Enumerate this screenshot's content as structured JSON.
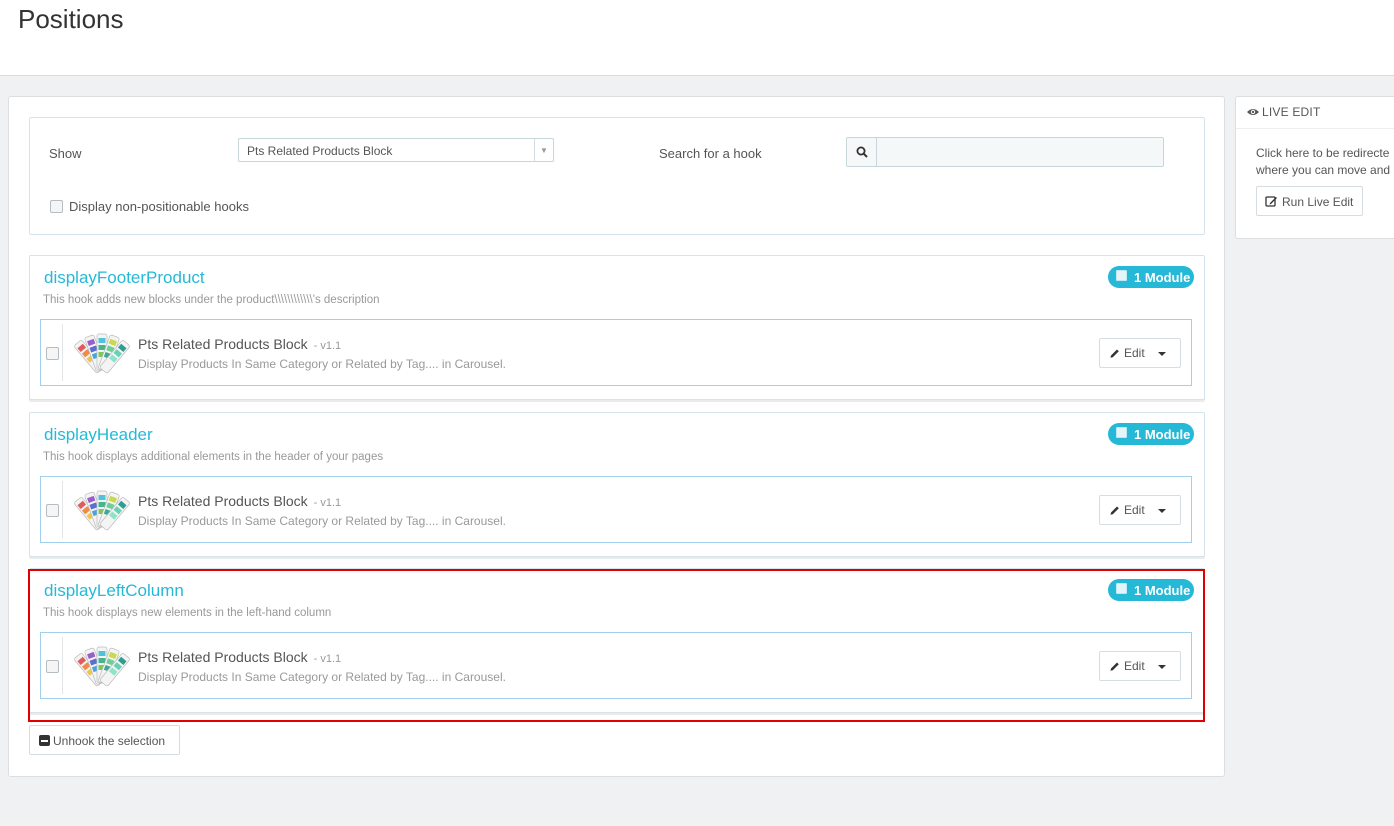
{
  "header": {
    "title": "Positions"
  },
  "filters": {
    "show_label": "Show",
    "show_selected": "Pts Related Products Block",
    "search_label": "Search for a hook",
    "search_value": "",
    "non_positionable_label": "Display non-positionable hooks"
  },
  "hooks": [
    {
      "name": "displayFooterProduct",
      "description": "This hook adds new blocks under the product\\\\\\\\\\\\\\\\\\\\\\\\'s description",
      "badge": "1 Module",
      "module": {
        "name": "Pts Related Products Block",
        "version": "- v1.1",
        "description": "Display Products In Same Category or Related by Tag.... in Carousel.",
        "edit_label": "Edit"
      }
    },
    {
      "name": "displayHeader",
      "description": "This hook displays additional elements in the header of your pages",
      "badge": "1 Module",
      "module": {
        "name": "Pts Related Products Block",
        "version": "- v1.1",
        "description": "Display Products In Same Category or Related by Tag.... in Carousel.",
        "edit_label": "Edit"
      }
    },
    {
      "name": "displayLeftColumn",
      "description": "This hook displays new elements in the left-hand column",
      "badge": "1 Module",
      "module": {
        "name": "Pts Related Products Block",
        "version": "- v1.1",
        "description": "Display Products In Same Category or Related by Tag.... in Carousel.",
        "edit_label": "Edit"
      }
    }
  ],
  "actions": {
    "unhook_label": "Unhook the selection"
  },
  "live_edit": {
    "title": "LIVE EDIT",
    "text_line1": "Click here to be redirecte",
    "text_line2": "where you can move and",
    "run_label": "Run Live Edit"
  },
  "colors": {
    "accent": "#25b9d7",
    "highlight": "#e00000"
  }
}
